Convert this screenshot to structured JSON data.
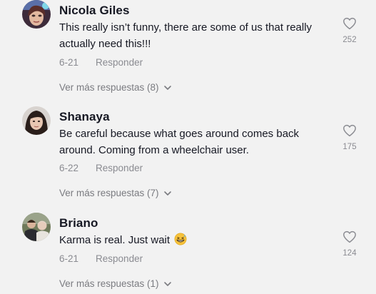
{
  "comments": [
    {
      "username": "Nicola Giles",
      "text": "This really isn’t funny, there are some of us that really actually need this!!!",
      "date": "6-21",
      "reply_label": "Responder",
      "likes": "252",
      "more_replies": "Ver más respuestas (8)",
      "avatar_icon": "avatar-photo"
    },
    {
      "username": "Shanaya",
      "text": "Be careful because what goes around comes back around. Coming from a wheelchair user.",
      "date": "6-22",
      "reply_label": "Responder",
      "likes": "175",
      "more_replies": "Ver más respuestas (7)",
      "avatar_icon": "avatar-photo"
    },
    {
      "username": "Briano",
      "text": "Karma is real. Just wait",
      "date": "6-21",
      "reply_label": "Responder",
      "likes": "124",
      "more_replies": "Ver más respuestas (1)",
      "avatar_icon": "avatar-photo",
      "trailing_emoji": "grinning-sweat-emoji"
    }
  ],
  "colors": {
    "background": "#f2f2f2",
    "text": "#161823",
    "muted": "#8a8b91"
  }
}
